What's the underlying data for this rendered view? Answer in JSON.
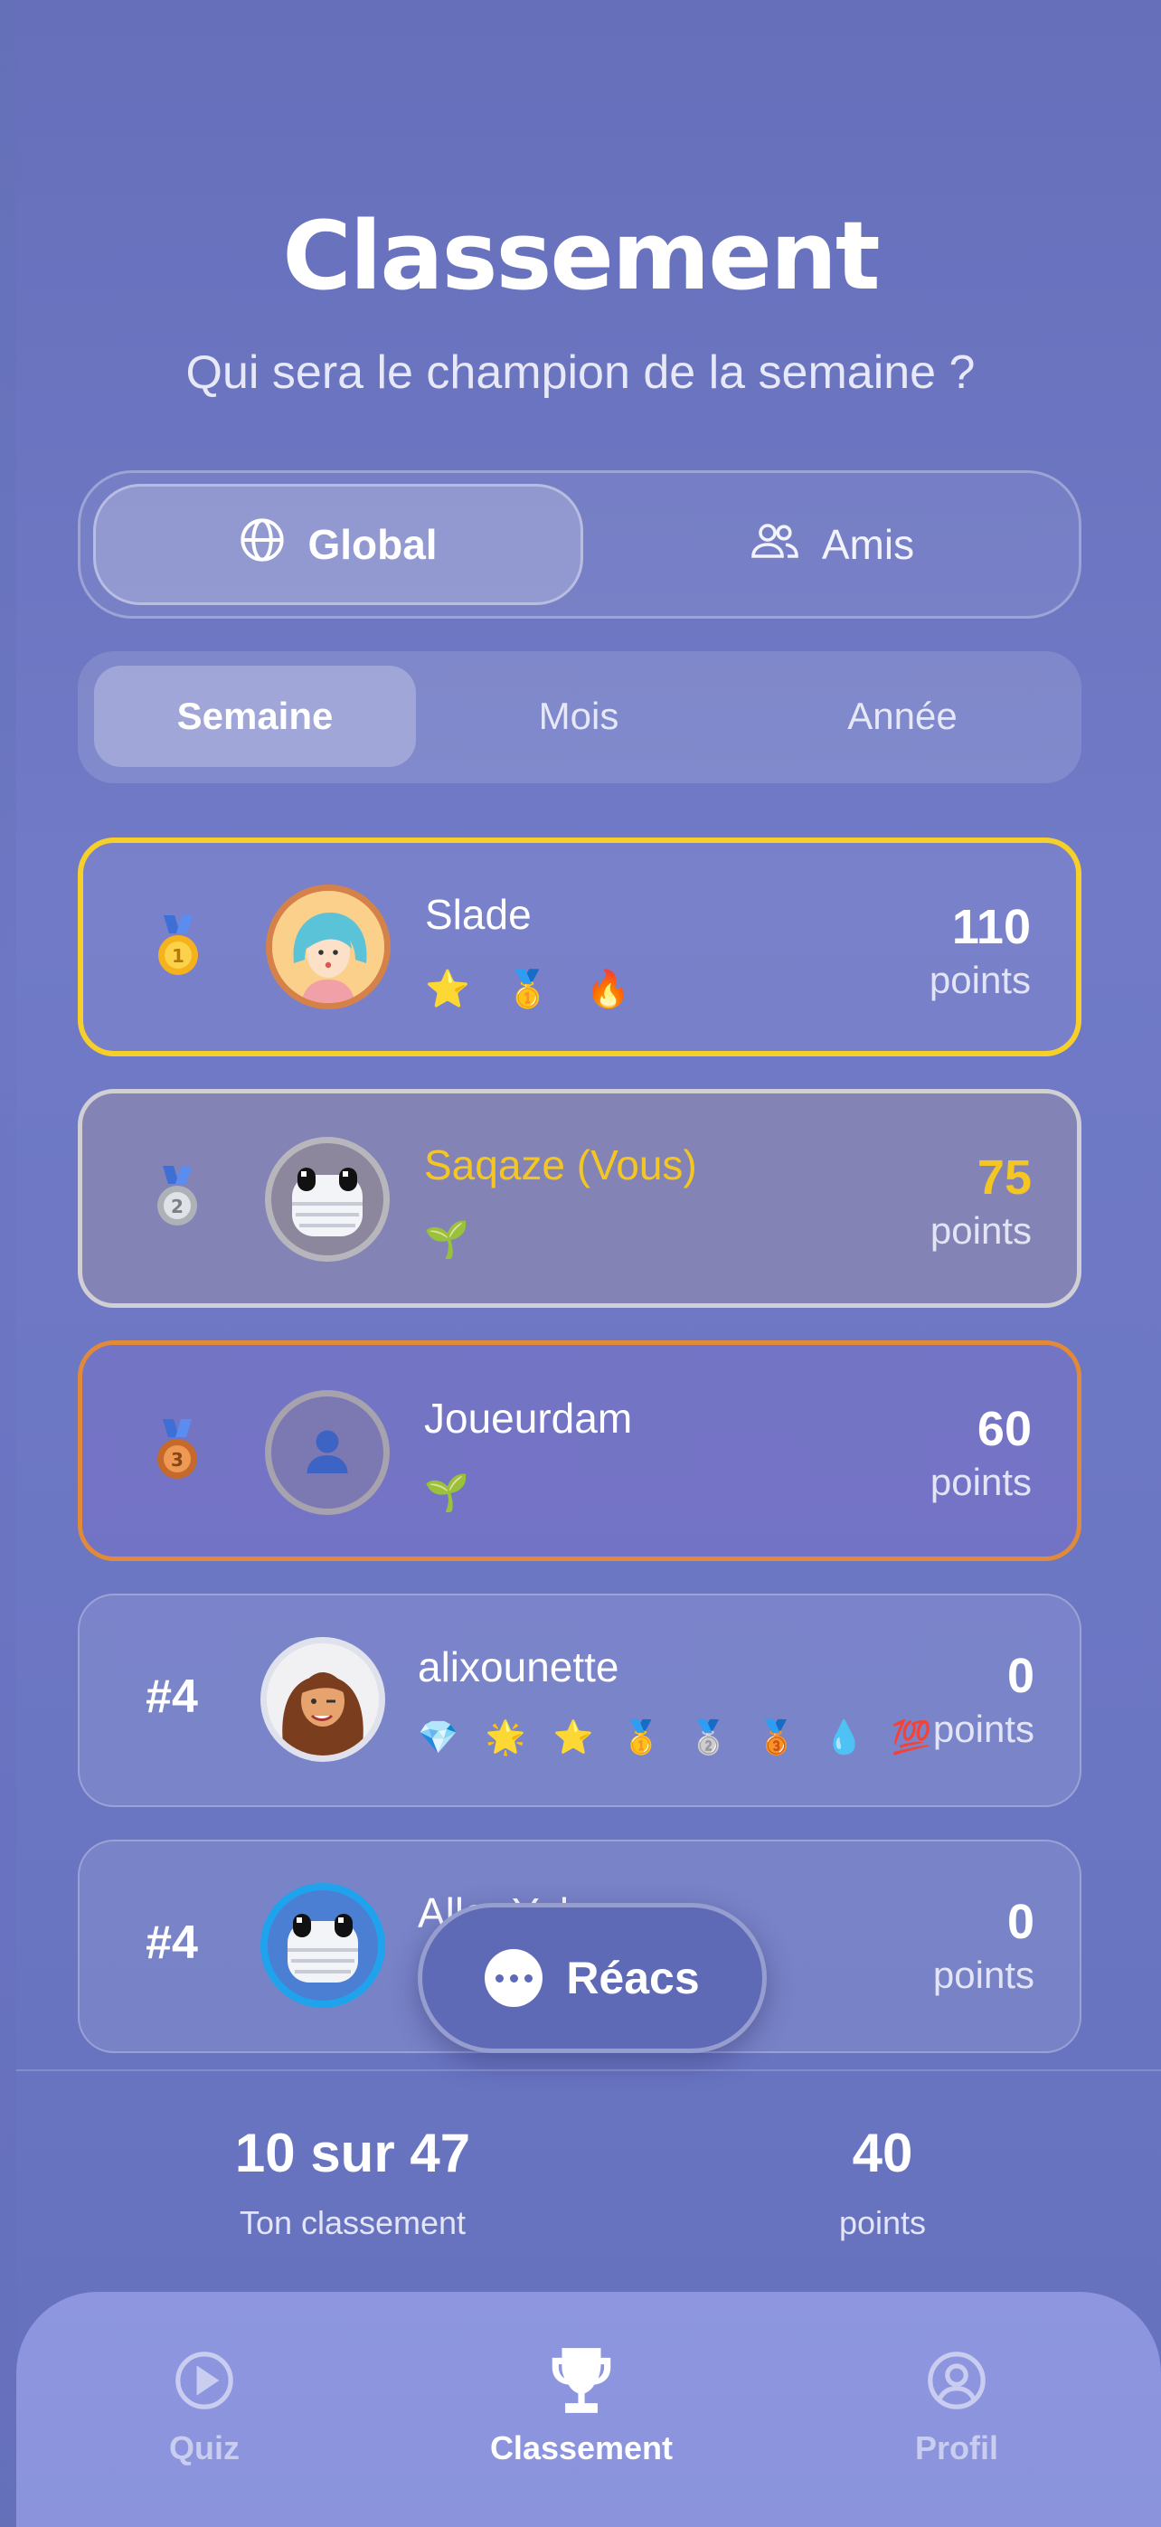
{
  "header": {
    "title": "Classement",
    "subtitle": "Qui sera le champion de la semaine ?"
  },
  "scope_tabs": [
    {
      "label": "Global",
      "icon": "globe-icon",
      "active": true
    },
    {
      "label": "Amis",
      "icon": "users-icon",
      "active": false
    }
  ],
  "period_tabs": [
    {
      "label": "Semaine",
      "active": true
    },
    {
      "label": "Mois",
      "active": false
    },
    {
      "label": "Année",
      "active": false
    }
  ],
  "leaderboard": [
    {
      "rank": "1st-medal",
      "name": "Slade",
      "badges": "⭐ 🥇 🔥",
      "points": "110",
      "points_label": "points",
      "border": "#f6cf2a"
    },
    {
      "rank": "2nd-medal",
      "name": "Saqaze (Vous)",
      "badges": "🌱",
      "points": "75",
      "points_label": "points",
      "border": "#cfcfd4",
      "highlight": "#f3c623"
    },
    {
      "rank": "3rd-medal",
      "name": "Joueurdam",
      "badges": "🌱",
      "points": "60",
      "points_label": "points",
      "border": "#e08a3a"
    },
    {
      "rank": "#4",
      "name": "alixounette",
      "badges": "💎 🌟 ⭐ 🥇 🥈 🥉 💧 💯",
      "points": "0",
      "points_label": "points"
    },
    {
      "rank": "#4",
      "name": "Aller Yala",
      "badges": "🏆 🌱",
      "points": "0",
      "points_label": "points"
    }
  ],
  "fab": {
    "label": "Réacs",
    "icon": "chat-bubble-icon"
  },
  "summary": {
    "rank_value": "10 sur 47",
    "rank_label": "Ton classement",
    "points_value": "40",
    "points_label": "points"
  },
  "tabbar": [
    {
      "label": "Quiz",
      "icon": "play-icon",
      "active": false
    },
    {
      "label": "Classement",
      "icon": "trophy-icon",
      "active": true
    },
    {
      "label": "Profil",
      "icon": "profile-icon",
      "active": false
    }
  ],
  "colors": {
    "gold": "#f6cf2a",
    "silver": "#cfcfd4",
    "bronze": "#e08a3a",
    "you": "#f3c623"
  }
}
